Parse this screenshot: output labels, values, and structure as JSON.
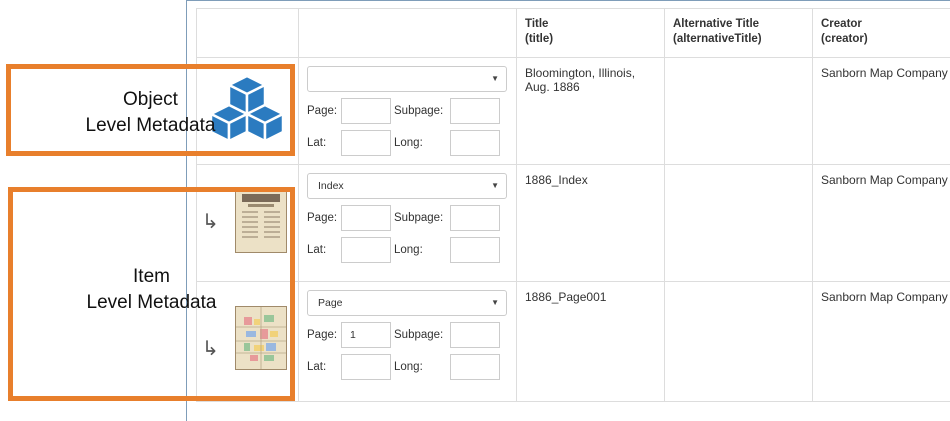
{
  "callouts": {
    "object": {
      "line1": "Object",
      "line2": "Level Metadata"
    },
    "item": {
      "line1": "Item",
      "line2": "Level Metadata"
    }
  },
  "columns": [
    "Title\n(title)",
    "Alternative Title\n(alternativeTitle)",
    "Creator\n(creator)"
  ],
  "header": {
    "title_l1": "Title",
    "title_l2": "(title)",
    "alt_l1": "Alternative Title",
    "alt_l2": "(alternativeTitle)",
    "creator_l1": "Creator",
    "creator_l2": "(creator)"
  },
  "labels": {
    "page": "Page:",
    "subpage": "Subpage:",
    "lat": "Lat:",
    "long": "Long:"
  },
  "rows": [
    {
      "select": "",
      "page": "",
      "title": "Bloomington, Illinois, Aug. 1886",
      "alt": "",
      "creator": "Sanborn Map Company",
      "icon": "cubes-icon"
    },
    {
      "select": "Index",
      "page": "",
      "title": "1886_Index",
      "alt": "",
      "creator": "Sanborn Map Company",
      "icon": "map-thumbnail"
    },
    {
      "select": "Page",
      "page": "1",
      "title": "1886_Page001",
      "alt": "",
      "creator": "Sanborn Map Company",
      "icon": "map-thumbnail"
    }
  ],
  "colors": {
    "callout": "#e87f2c",
    "cubes": "#2b7bc0"
  }
}
